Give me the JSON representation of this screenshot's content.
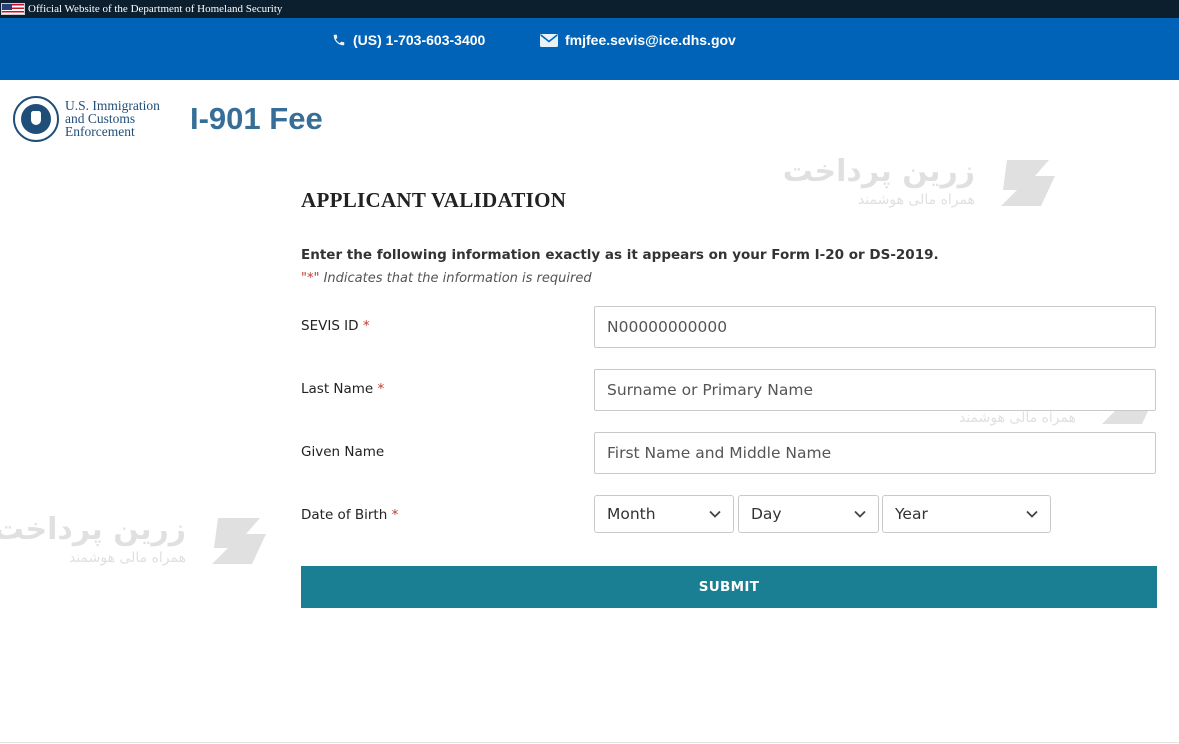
{
  "gov_banner": {
    "text": "Official Website of the Department of Homeland Security"
  },
  "contact": {
    "phone": "(US) 1-703-603-3400",
    "email": "fmjfee.sevis@ice.dhs.gov"
  },
  "header": {
    "agency_line1": "U.S. Immigration",
    "agency_line2": "and Customs",
    "agency_line3": "Enforcement",
    "site_title": "I-901 Fee"
  },
  "watermark": {
    "name": "زرین پرداخت",
    "tagline": "همراه مالی هوشمند"
  },
  "form": {
    "heading": "APPLICANT VALIDATION",
    "instructions": "Enter the following information exactly as it appears on your Form I-20 or DS-2019.",
    "required_note_mark": "\"*\"",
    "required_note_text": " Indicates that the information is required",
    "required_marker": "*",
    "sevis_id": {
      "label": "SEVIS ID",
      "placeholder": "N00000000000"
    },
    "last_name": {
      "label": "Last Name",
      "placeholder": "Surname or Primary Name"
    },
    "given_name": {
      "label": "Given Name",
      "placeholder": "First Name and Middle Name"
    },
    "dob": {
      "label": "Date of Birth",
      "month": "Month",
      "day": "Day",
      "year": "Year"
    },
    "submit_label": "SUBMIT"
  },
  "colors": {
    "banner_bg": "#0b1f2e",
    "contact_bar_bg": "#0063b8",
    "title_color": "#366e97",
    "submit_bg": "#1b7f94",
    "required_star": "#c0392b"
  }
}
